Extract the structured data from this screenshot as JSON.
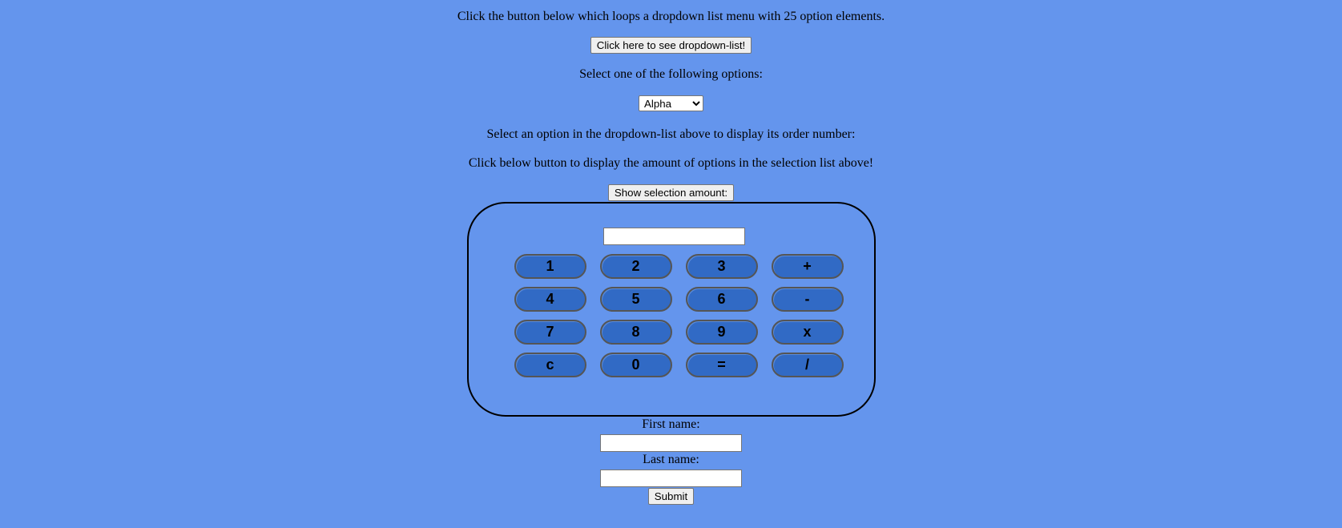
{
  "intro": {
    "text": "Click the button below which loops a dropdown list menu with 25 option elements.",
    "dropdown_button_label": "Click here to see dropdown-list!"
  },
  "selection": {
    "prompt": "Select one of the following options:",
    "selected_value": "Alpha",
    "order_hint": "Select an option in the dropdown-list above to display its order number:",
    "amount_hint": "Click below button to display the amount of options in the selection list above!",
    "amount_button_label": "Show selection amount:"
  },
  "calculator": {
    "display_value": "",
    "keys": [
      "1",
      "2",
      "3",
      "+",
      "4",
      "5",
      "6",
      "-",
      "7",
      "8",
      "9",
      "x",
      "c",
      "0",
      "=",
      "/"
    ]
  },
  "form": {
    "first_name_label": "First name:",
    "first_name_value": "",
    "last_name_label": "Last name:",
    "last_name_value": "",
    "submit_label": "Submit"
  }
}
